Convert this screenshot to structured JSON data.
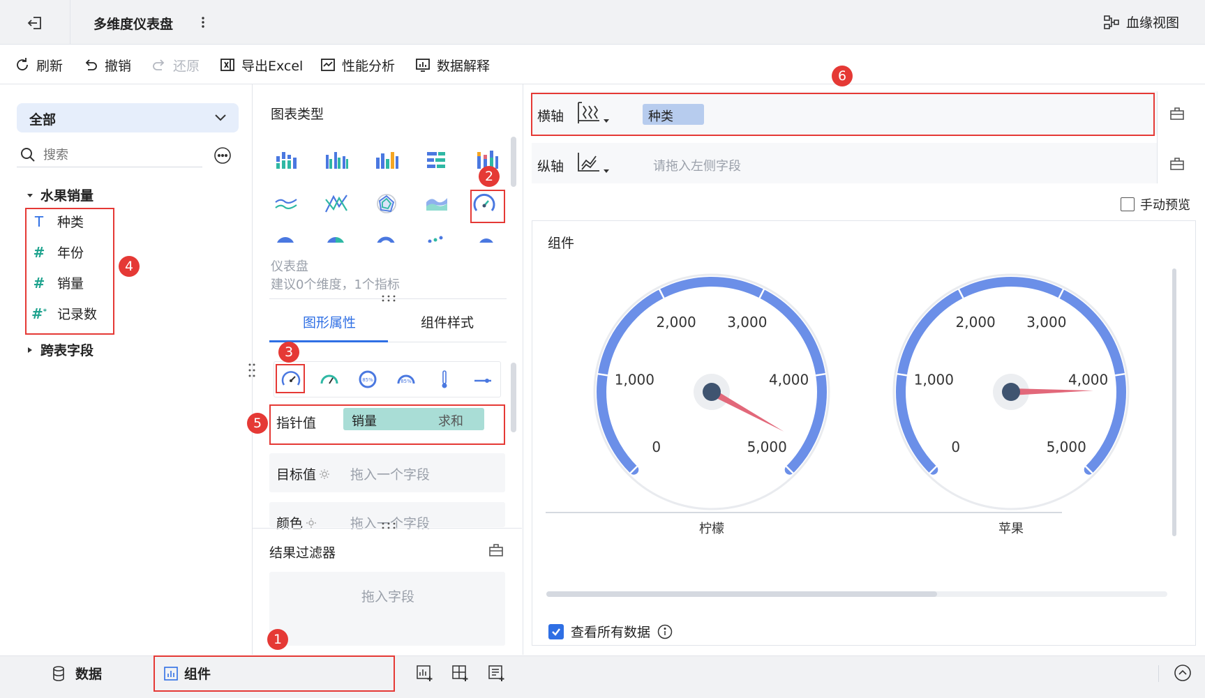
{
  "header": {
    "title": "多维度仪表盘",
    "lineage_label": "血缘视图"
  },
  "toolbar": {
    "refresh": "刷新",
    "undo": "撤销",
    "redo": "还原",
    "export": "导出Excel",
    "perf": "性能分析",
    "explain": "数据解释"
  },
  "left_panel": {
    "dropdown_value": "全部",
    "search_placeholder": "搜索",
    "dataset_name": "水果销量",
    "fields": [
      {
        "name": "种类",
        "type": "text"
      },
      {
        "name": "年份",
        "type": "number"
      },
      {
        "name": "销量",
        "type": "number"
      },
      {
        "name": "记录数",
        "type": "number-calc"
      }
    ],
    "cross_table": "跨表字段"
  },
  "middle_panel": {
    "chart_type_title": "图表类型",
    "selected_chart_name": "仪表盘",
    "selected_chart_hint": "建议0个维度，1个指标",
    "tabs": [
      "图形属性",
      "组件样式"
    ],
    "active_tab": "图形属性",
    "pointer_label": "指针值",
    "pointer_field": "销量",
    "pointer_agg": "求和",
    "target_label": "目标值",
    "target_placeholder": "拖入一个字段",
    "color_label": "颜色",
    "color_placeholder": "拖入一个字段",
    "result_filter": "结果过滤器",
    "filter_placeholder": "拖入字段"
  },
  "right_panel": {
    "x_axis_label": "横轴",
    "x_axis_field": "种类",
    "y_axis_label": "纵轴",
    "y_axis_placeholder": "请拖入左侧字段",
    "manual_preview": "手动预览",
    "widget_title": "组件",
    "view_all_data": "查看所有数据"
  },
  "gauges": [
    {
      "category": "柠檬",
      "value": 4700,
      "min": 0,
      "max": 5000,
      "ticks": [
        "0",
        "1,000",
        "2,000",
        "3,000",
        "4,000",
        "5,000"
      ]
    },
    {
      "category": "苹果",
      "value": 4150,
      "min": 0,
      "max": 5000,
      "ticks": [
        "0",
        "1,000",
        "2,000",
        "3,000",
        "4,000",
        "5,000"
      ]
    }
  ],
  "bottom_bar": {
    "data_tab": "数据",
    "widget_tab": "组件"
  },
  "badges": [
    "1",
    "2",
    "3",
    "4",
    "5",
    "6"
  ],
  "colors": {
    "accent": "#2f6fe4",
    "gauge_arc": "#6b8fe8",
    "needle": "#e2687a",
    "hub": "#3f5470",
    "field_pill": "#b7ccee",
    "measure_pill": "#a9ddd6",
    "annotation_red": "#e53935"
  }
}
